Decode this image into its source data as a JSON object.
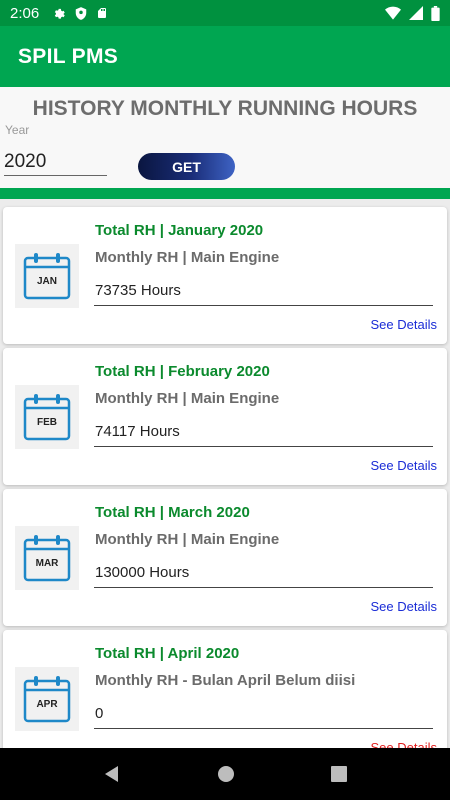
{
  "status_bar": {
    "time": "2:06",
    "left_icons": [
      "gear-icon",
      "shield-icon",
      "sd-card-icon"
    ],
    "right_icons": [
      "wifi-icon",
      "signal-icon",
      "battery-icon"
    ]
  },
  "app_bar": {
    "title": "SPIL PMS"
  },
  "filter": {
    "heading": "HISTORY MONTHLY RUNNING HOURS",
    "year_label": "Year",
    "year_value": "2020",
    "get_label": "GET"
  },
  "cards": [
    {
      "month_abbr": "JAN",
      "title": "Total RH | January 2020",
      "subtitle": "Monthly RH | Main Engine",
      "value": "73735 Hours",
      "link": "See Details"
    },
    {
      "month_abbr": "FEB",
      "title": "Total RH | February 2020",
      "subtitle": "Monthly RH | Main Engine",
      "value": "74117 Hours",
      "link": "See Details"
    },
    {
      "month_abbr": "MAR",
      "title": "Total RH | March 2020",
      "subtitle": "Monthly RH | Main Engine",
      "value": "130000 Hours",
      "link": "See Details"
    },
    {
      "month_abbr": "APR",
      "title": "Total RH | April 2020",
      "subtitle": "Monthly RH - Bulan April Belum diisi",
      "value": "0",
      "link": "See Details"
    }
  ],
  "colors": {
    "primary_green": "#00a651",
    "status_green": "#00913f",
    "title_green": "#0b8a2d",
    "link_blue": "#1a2cd6",
    "link_red": "#e02020",
    "calendar_blue": "#1e88c8"
  },
  "nav_bar": {
    "icons": [
      "back-icon",
      "home-icon",
      "recents-icon"
    ]
  }
}
